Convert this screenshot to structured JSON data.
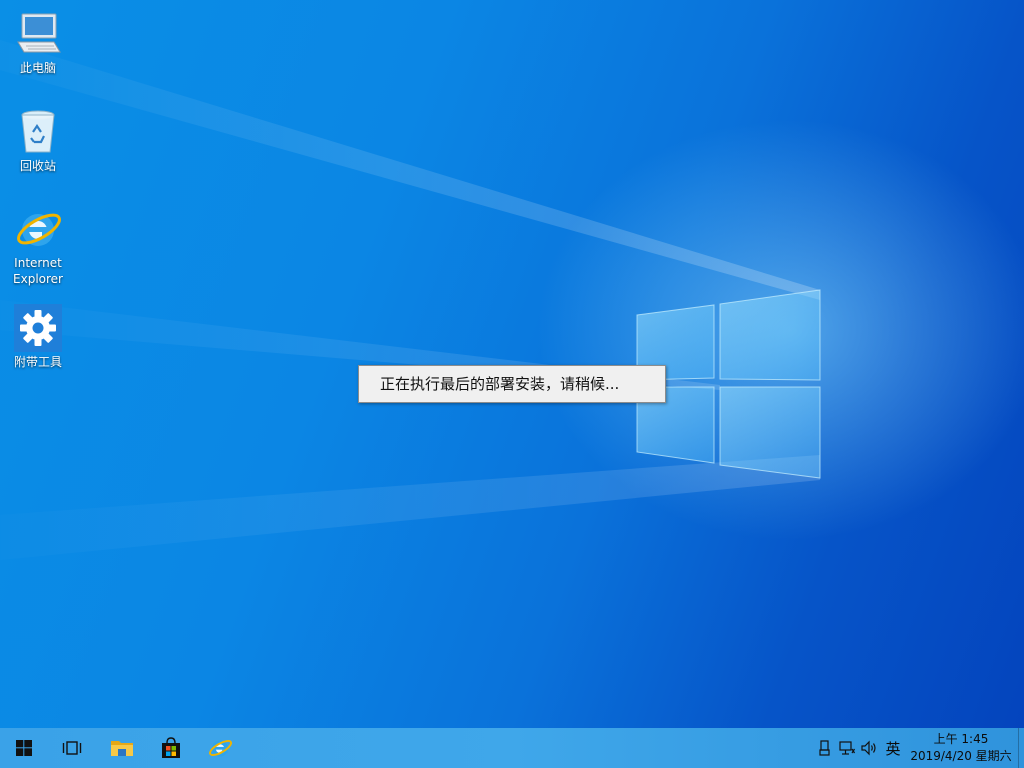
{
  "desktop": {
    "icons": [
      {
        "label": "此电脑",
        "icon": "this-pc-icon"
      },
      {
        "label": "回收站",
        "icon": "recycle-bin-icon"
      },
      {
        "label": "Internet Explorer",
        "icon": "internet-explorer-icon"
      },
      {
        "label": "附带工具",
        "icon": "gear-icon"
      }
    ]
  },
  "dialog": {
    "message": "正在执行最后的部署安装，请稍候..."
  },
  "taskbar": {
    "buttons": [
      {
        "name": "start",
        "icon": "windows-logo-icon"
      },
      {
        "name": "task-view",
        "icon": "task-view-icon"
      },
      {
        "name": "file-explorer",
        "icon": "folder-icon"
      },
      {
        "name": "store",
        "icon": "store-bag-icon"
      },
      {
        "name": "internet-explorer",
        "icon": "internet-explorer-icon"
      }
    ],
    "tray": {
      "ime_label": "英"
    },
    "clock": {
      "time": "上午 1:45",
      "date": "2019/4/20 星期六"
    }
  },
  "colors": {
    "accent": "#0a78d7",
    "taskbar": "#3ba3e8",
    "dialog_bg": "#f0f0f0"
  }
}
